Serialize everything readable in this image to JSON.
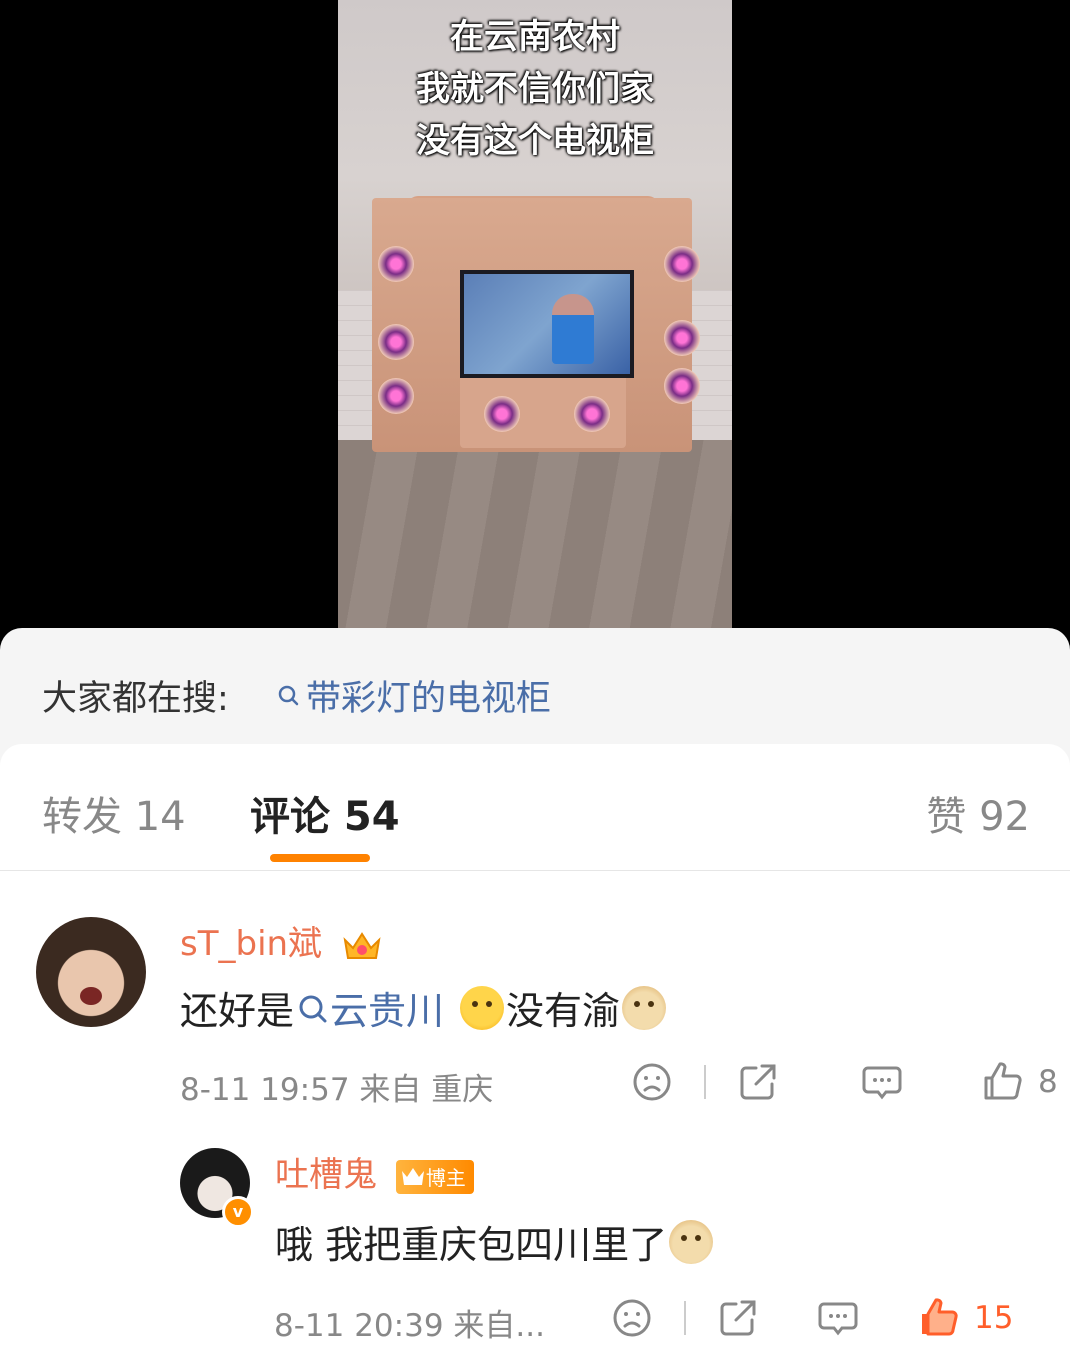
{
  "video": {
    "overlay_lines": [
      "在云南农村",
      "我就不信你们家",
      "没有这个电视柜"
    ]
  },
  "search": {
    "label": "大家都在搜:",
    "term": "带彩灯的电视柜"
  },
  "tabs": {
    "forward": "转发 14",
    "comment": "评论 54",
    "like": "赞 92"
  },
  "comments": [
    {
      "user": "sT_bin斌",
      "text_before": "还好是",
      "link": "云贵川",
      "text_middle": "没有渝",
      "meta": "8-11 19:57  来自 重庆",
      "likes": "8"
    },
    {
      "user": "吐槽鬼",
      "badge": "博主",
      "text": "哦 我把重庆包四川里了",
      "meta": "8-11 20:39  来自...",
      "likes": "15"
    }
  ],
  "colors": {
    "accent": "#ff8200",
    "username": "#eb7350",
    "link": "#4a6ea8",
    "liked": "#ff5e2a"
  },
  "icons": [
    "search-icon",
    "crown-icon",
    "dislike-face-icon",
    "share-icon",
    "comment-bubble-icon",
    "thumbs-up-icon",
    "verified-icon"
  ]
}
